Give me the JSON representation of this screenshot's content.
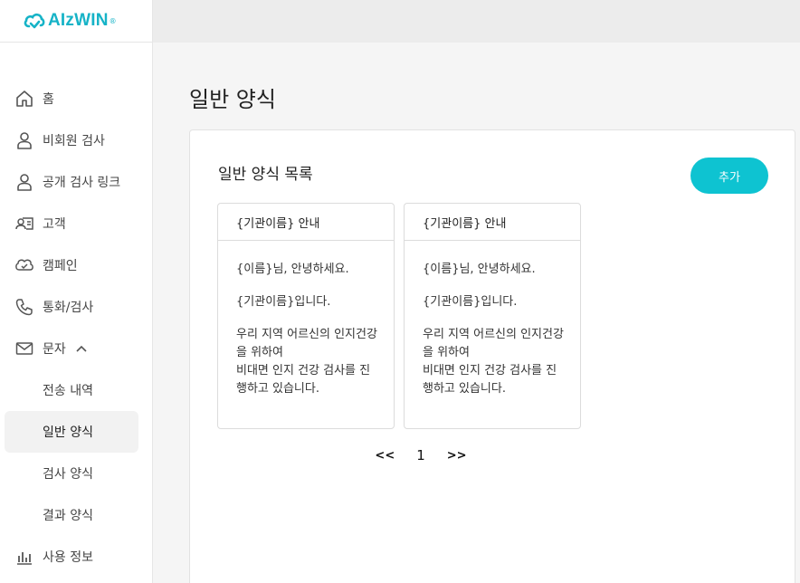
{
  "brand": {
    "name": "AIzWIN",
    "reg_mark": "®",
    "color": "#16b3c7"
  },
  "sidebar": {
    "items": [
      {
        "label": "홈",
        "icon": "home-icon"
      },
      {
        "label": "비회원 검사",
        "icon": "person-icon"
      },
      {
        "label": "공개 검사 링크",
        "icon": "person-icon"
      },
      {
        "label": "고객",
        "icon": "contact-card-icon"
      },
      {
        "label": "캠페인",
        "icon": "campaign-icon"
      },
      {
        "label": "통화/검사",
        "icon": "phone-icon"
      },
      {
        "label": "문자",
        "icon": "mail-icon",
        "expanded": true
      }
    ],
    "sub_items": [
      {
        "label": "전송 내역",
        "active": false
      },
      {
        "label": "일반 양식",
        "active": true
      },
      {
        "label": "검사 양식",
        "active": false
      },
      {
        "label": "결과 양식",
        "active": false
      }
    ],
    "bottom_item": {
      "label": "사용 정보",
      "icon": "bar-chart-icon"
    }
  },
  "main": {
    "page_title": "일반 양식",
    "panel_title": "일반 양식 목록",
    "add_button_label": "추가",
    "accent_color": "#0ec3d1",
    "cards": [
      {
        "title": "{기관이름} 안내",
        "lines": [
          "{이름}님, 안녕하세요.",
          "{기관이름}입니다.",
          "우리 지역 어르신의 인지건강을 위하여",
          "비대면 인지 건강 검사를 진행하고 있습니다."
        ]
      },
      {
        "title": "{기관이름} 안내",
        "lines": [
          "{이름}님, 안녕하세요.",
          "{기관이름}입니다.",
          "우리 지역 어르신의 인지건강을 위하여",
          "비대면 인지 건강 검사를 진행하고 있습니다."
        ]
      }
    ],
    "pagination": {
      "prev": "<<",
      "current": "1",
      "next": ">>"
    }
  }
}
